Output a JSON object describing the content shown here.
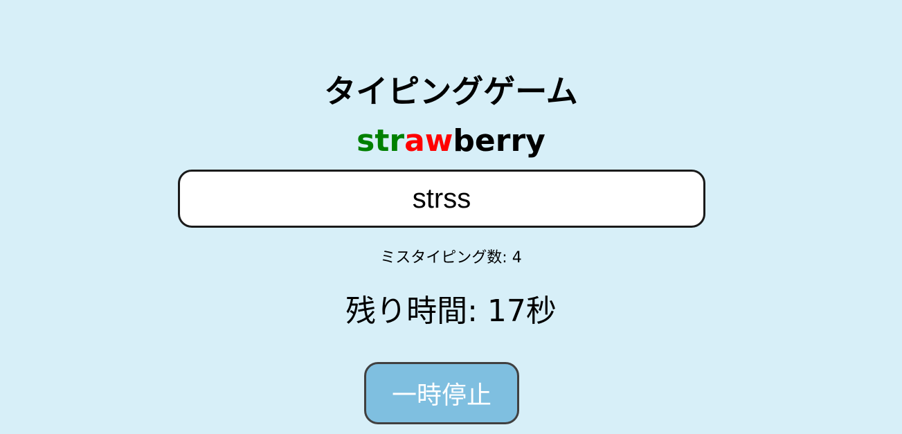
{
  "app": {
    "title": "タイピングゲーム"
  },
  "word": {
    "correct": "str",
    "wrong": "aw",
    "pending": "berry",
    "correct_color": "#008000",
    "wrong_color": "#ff0000",
    "pending_color": "#000000"
  },
  "input": {
    "value": "strss"
  },
  "stats": {
    "miss_label": "ミスタイピング数: 4",
    "time_label": "残り時間: 17秒"
  },
  "controls": {
    "pause_label": "一時停止",
    "pause_bg_color": "#7fbfe0"
  }
}
